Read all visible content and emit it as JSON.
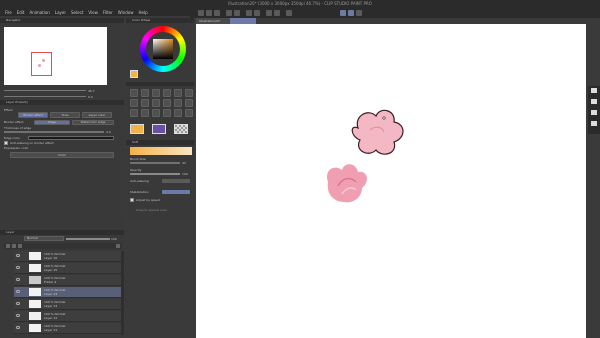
{
  "window": {
    "title": "Illustration20* (3000 x 3000px 350dpi 46.7%) - CLIP STUDIO PAINT PRO"
  },
  "menu": [
    "File",
    "Edit",
    "Animation",
    "Layer",
    "Select",
    "View",
    "Filter",
    "Window",
    "Help"
  ],
  "navigator": {
    "title": "Navigator",
    "zoom": "46.7",
    "angle": "0.0"
  },
  "color_panel": {
    "title": "Color Wheel"
  },
  "tabs": {
    "canvas": "Illustration20*"
  },
  "layer_property": {
    "tabs": [
      "Layer Property"
    ],
    "effect_label": "Effect",
    "effect_buttons": [
      "Border effect",
      "Tone",
      "Layer color"
    ],
    "border_effect_label": "Border effect",
    "border_options": [
      "Edge",
      "Watercolor edge"
    ],
    "thickness_label": "Thickness of edge",
    "thickness_value": "4.0",
    "edge_color_label": "Edge color",
    "antialias_label": "Anti-aliasing on border effect",
    "expression_label": "Expression color",
    "expression_value": "Color"
  },
  "tool_property": {
    "title": "Soft",
    "brush_size_label": "Brush Size",
    "brush_size_value": "43",
    "opacity_label": "Opacity",
    "opacity_value": "100",
    "antialias_label": "Anti-aliasing",
    "stabilization_label": "Stabilization",
    "adjust_label": "Adjust by speed",
    "snap_label": "Snap to special ruler"
  },
  "layers_panel": {
    "title": "Layer",
    "blend_mode": "Normal",
    "opacity": "100",
    "layers": [
      {
        "line1": "100 % Normal",
        "line2": "Layer 16",
        "selected": false
      },
      {
        "line1": "100 % Normal",
        "line2": "Layer 15",
        "selected": false
      },
      {
        "line1": "100 % Normal",
        "line2": "Folder 4",
        "selected": false
      },
      {
        "line1": "100 % Normal",
        "line2": "Layer 14",
        "selected": true
      },
      {
        "line1": "100 % Normal",
        "line2": "Layer 13",
        "selected": false
      },
      {
        "line1": "100 % Normal",
        "line2": "Layer 12",
        "selected": false
      },
      {
        "line1": "100 % Normal",
        "line2": "Layer 11",
        "selected": false
      }
    ]
  },
  "colors": {
    "main": "#f2b24a",
    "sub": "#6b4ea8",
    "selection": "#5a5f78"
  }
}
